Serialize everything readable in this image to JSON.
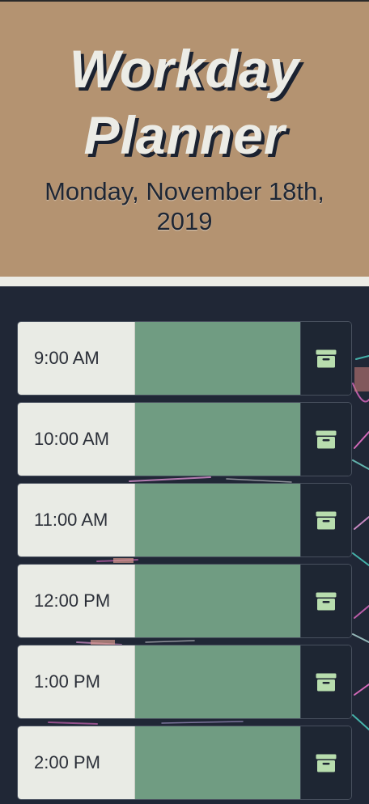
{
  "header": {
    "title_line1": "Workday",
    "title_line2": "Planner",
    "date_line1": "Monday, November 18th,",
    "date_line2": "2019"
  },
  "timeblocks": [
    {
      "hour": "9:00 AM",
      "task": "",
      "save_icon": "archive-icon"
    },
    {
      "hour": "10:00 AM",
      "task": "",
      "save_icon": "archive-icon"
    },
    {
      "hour": "11:00 AM",
      "task": "",
      "save_icon": "archive-icon"
    },
    {
      "hour": "12:00 PM",
      "task": "",
      "save_icon": "archive-icon"
    },
    {
      "hour": "1:00 PM",
      "task": "",
      "save_icon": "archive-icon"
    },
    {
      "hour": "2:00 PM",
      "task": "",
      "save_icon": "archive-icon"
    }
  ],
  "colors": {
    "header_bg": "#b49371",
    "title": "#ecece6",
    "hour_bg": "#e9ebe5",
    "future_block": "#709c82",
    "save_bg": "#1e2633",
    "save_icon": "#b8ddae",
    "page_bg": "#202736"
  }
}
